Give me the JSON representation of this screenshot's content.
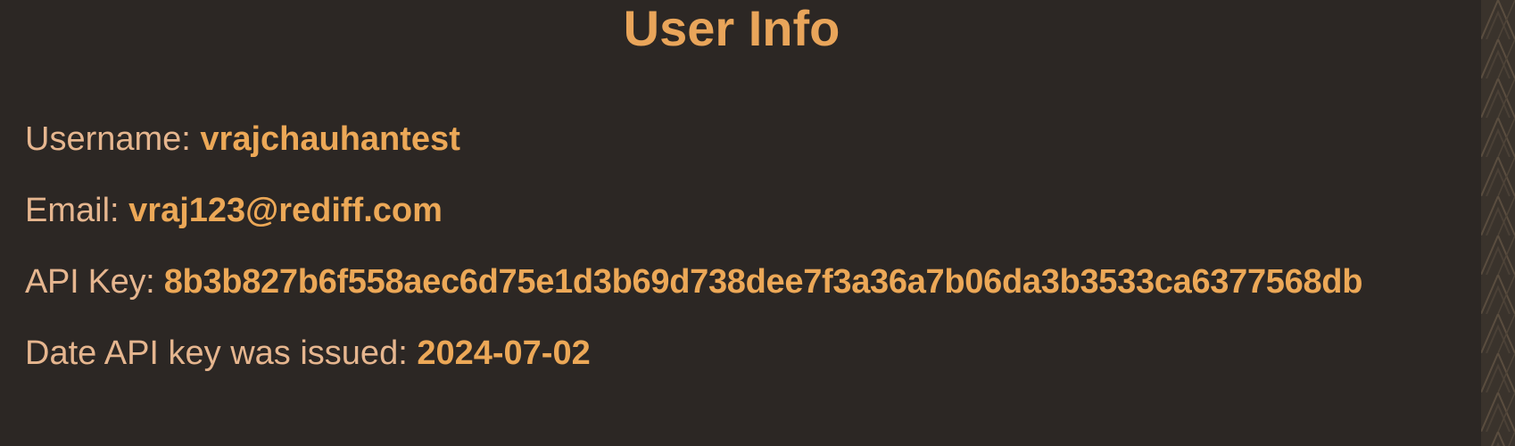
{
  "page": {
    "title": "User Info"
  },
  "user_info": {
    "username_label": "Username: ",
    "username": "vrajchauhantest",
    "email_label": "Email: ",
    "email": "vraj123@rediff.com",
    "api_key_label": "API Key: ",
    "api_key": "8b3b827b6f558aec6d75e1d3b69d738dee7f3a36a7b06da3b3533ca6377568db",
    "date_label": "Date API key was issued: ",
    "date_issued": "2024-07-02"
  },
  "colors": {
    "background": "#2c2724",
    "accent": "#eca857",
    "label_text": "#e6b68f"
  }
}
